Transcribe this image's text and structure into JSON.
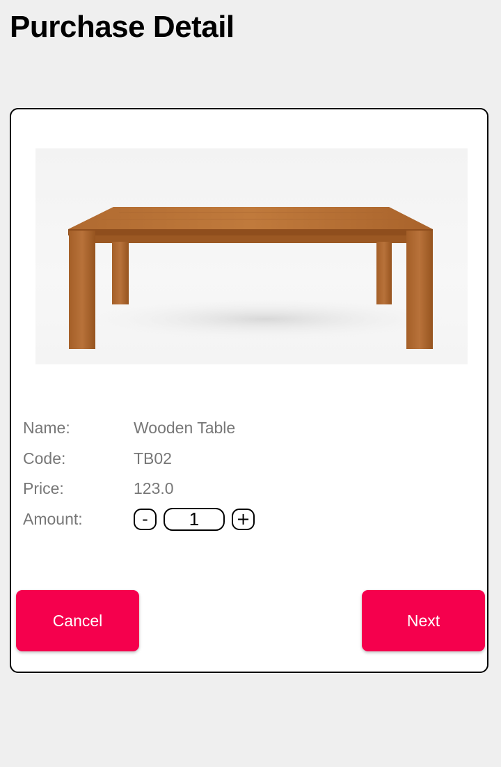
{
  "header": {
    "title": "Purchase Detail"
  },
  "product": {
    "image_icon": "wooden-table-photo",
    "fields": {
      "name_label": "Name:",
      "name_value": "Wooden Table",
      "code_label": "Code:",
      "code_value": "TB02",
      "price_label": "Price:",
      "price_value": "123.0",
      "amount_label": "Amount:"
    },
    "amount": {
      "decrement_label": "-",
      "value": "1",
      "increment_label": "+"
    }
  },
  "actions": {
    "cancel_label": "Cancel",
    "next_label": "Next"
  },
  "colors": {
    "background": "#efefef",
    "card": "#ffffff",
    "button_accent": "#f5004d",
    "label_text": "#777777"
  }
}
